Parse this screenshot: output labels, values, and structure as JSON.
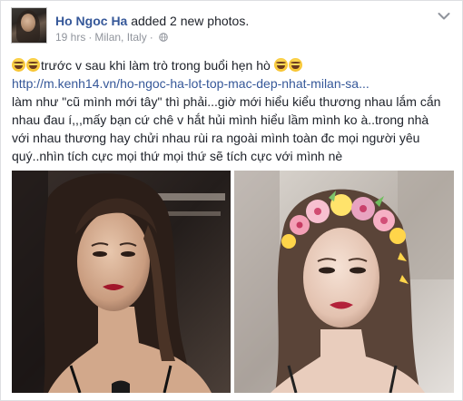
{
  "post": {
    "author_name": "Ho Ngoc Ha",
    "action": "added 2 new photos.",
    "time": "19 hrs",
    "location": "Milan, Italy",
    "separator": "·",
    "privacy_icon": "globe-icon",
    "menu_icon": "chevron-down-icon",
    "text_line1": "trước v sau khi làm trò trong buổi hẹn hò",
    "link": "http://m.kenh14.vn/ho-ngoc-ha-lot-top-mac-dep-nhat-milan-sa...",
    "paragraph": "làm như \"cũ mình mới tây\" thì phải...giờ mới hiểu kiểu thương nhau lắm cắn nhau đau í,,,mấy bạn cứ chê v hắt hủi mình hiểu lầm mình ko à..trong nhà với nhau thương hay chửi nhau rùi ra ngoài mình toàn đc mọi người yêu quý..nhìn tích cực mọi thứ mọi thứ sẽ tích cực với mình nè",
    "emoji_icon": "grinning-tears-emoji"
  },
  "photos": [
    {
      "name": "photo-before",
      "description_icon": "portrait-photo"
    },
    {
      "name": "photo-after",
      "description_icon": "flower-crown-filter-photo"
    }
  ],
  "colors": {
    "link": "#365899",
    "text": "#1d2129",
    "meta": "#90949c",
    "border": "#dddfe2"
  }
}
